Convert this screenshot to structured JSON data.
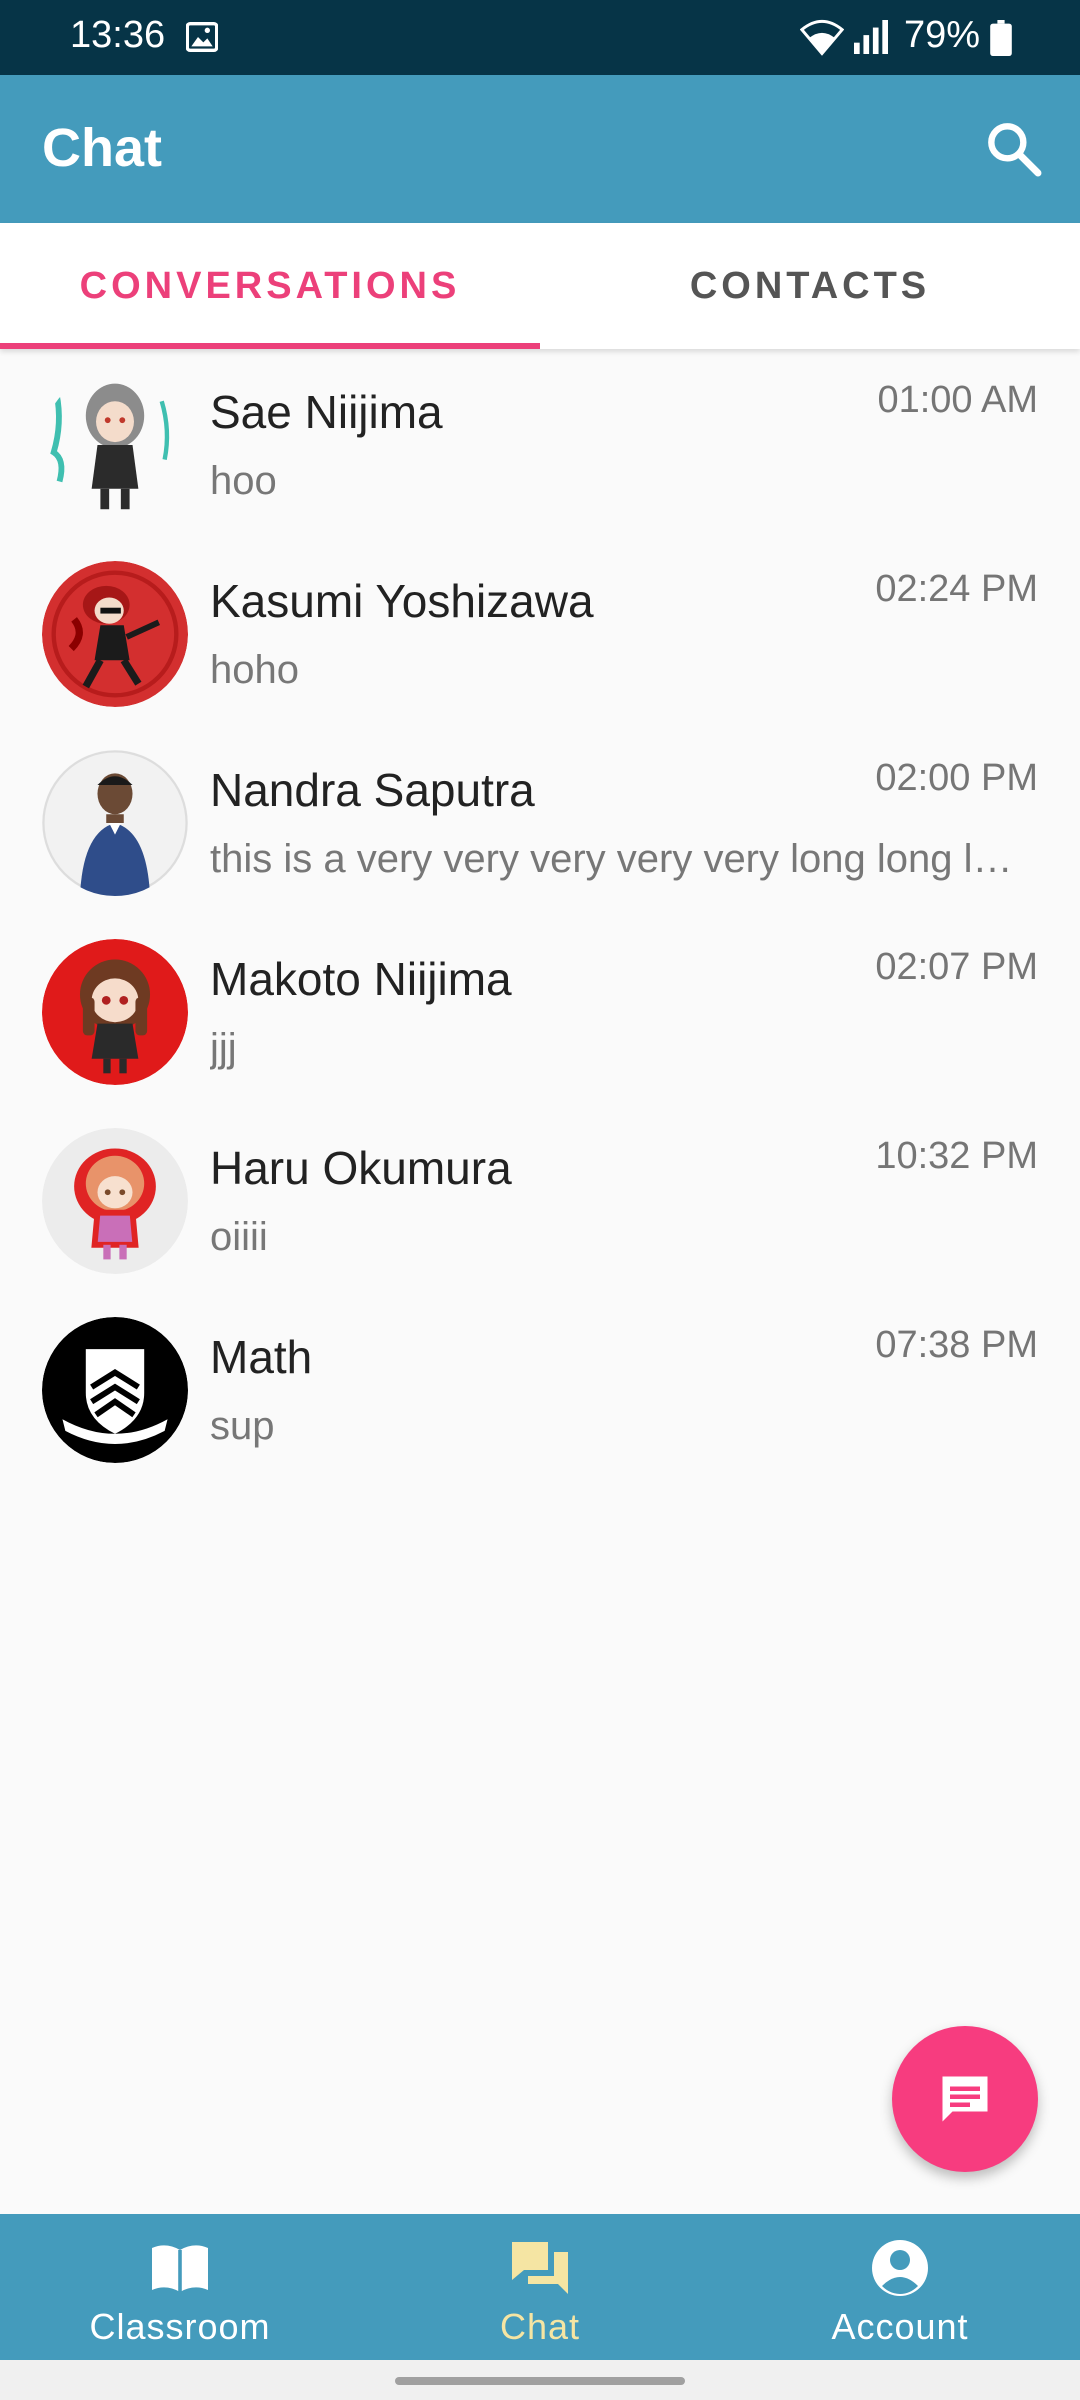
{
  "status_bar": {
    "time": "13:36",
    "battery": "79%",
    "icons": [
      "image-icon",
      "wifi-icon",
      "signal-icon",
      "battery-icon"
    ]
  },
  "app_bar": {
    "title": "Chat",
    "search_icon": "search-icon"
  },
  "tabs": [
    {
      "label": "CONVERSATIONS",
      "active": true
    },
    {
      "label": "CONTACTS",
      "active": false
    }
  ],
  "conversations": [
    {
      "name": "Sae Niijima",
      "message": "hoo",
      "time": "01:00 AM"
    },
    {
      "name": "Kasumi Yoshizawa",
      "message": "hoho",
      "time": "02:24 PM"
    },
    {
      "name": "Nandra Saputra",
      "message": "this is a very very very very very long long long message",
      "time": "02:00 PM"
    },
    {
      "name": "Makoto Niijima",
      "message": "jjj",
      "time": "02:07 PM"
    },
    {
      "name": "Haru Okumura",
      "message": "oiiii",
      "time": "10:32 PM"
    },
    {
      "name": "Math",
      "message": "sup",
      "time": "07:38 PM"
    }
  ],
  "fab": {
    "icon": "message-icon"
  },
  "bottom_nav": [
    {
      "label": "Classroom",
      "icon": "book-icon",
      "active": false
    },
    {
      "label": "Chat",
      "icon": "forum-icon",
      "active": true
    },
    {
      "label": "Account",
      "icon": "account-circle-icon",
      "active": false
    }
  ],
  "colors": {
    "status_bar": "#063447",
    "app_bar": "#449bbc",
    "accent_pink": "#ec407a",
    "fab": "#f73c7f",
    "nav_active": "#f5e5a3"
  }
}
